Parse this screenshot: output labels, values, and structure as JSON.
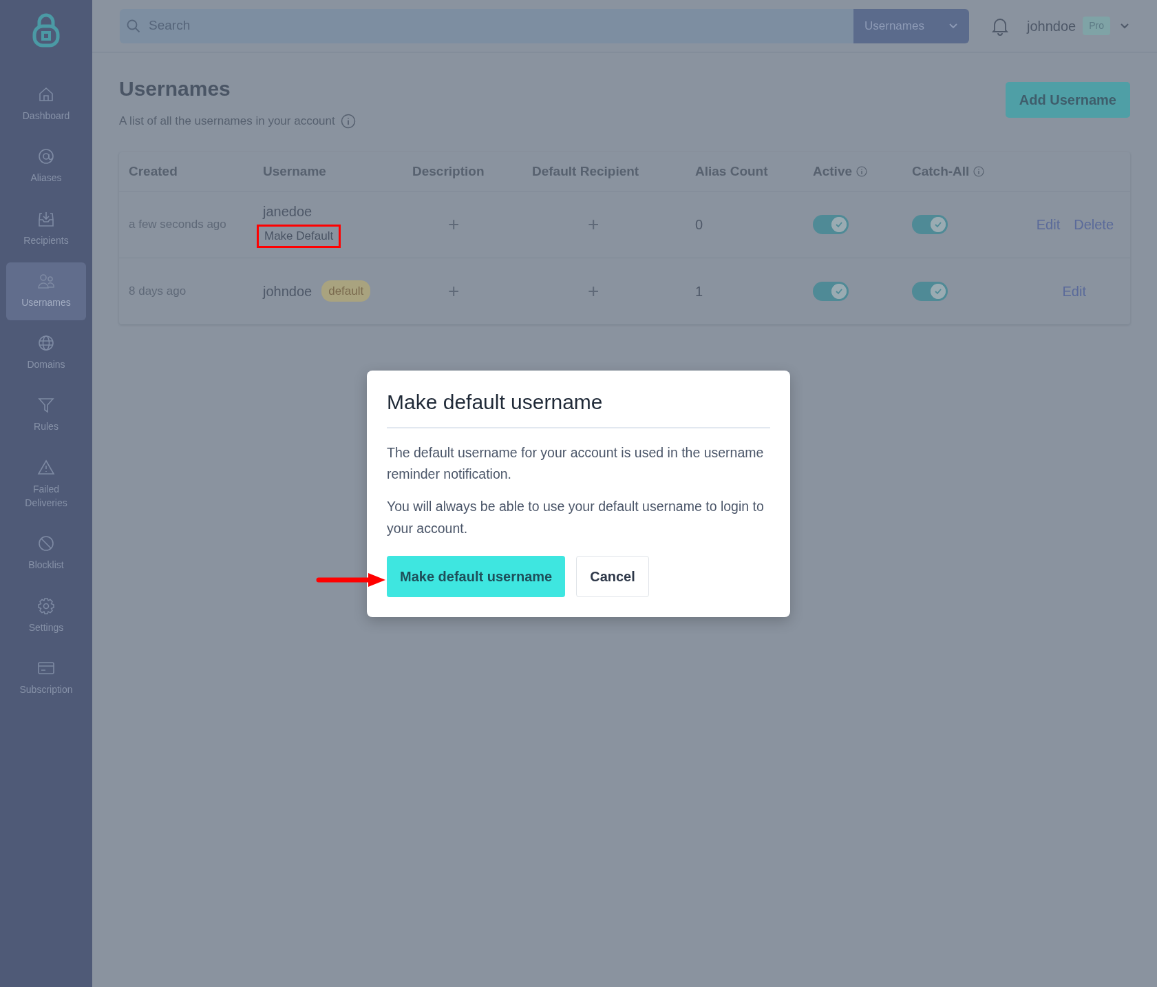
{
  "sidebar": {
    "items": [
      {
        "label": "Dashboard",
        "selected": false
      },
      {
        "label": "Aliases",
        "selected": false
      },
      {
        "label": "Recipients",
        "selected": false
      },
      {
        "label": "Usernames",
        "selected": true
      },
      {
        "label": "Domains",
        "selected": false
      },
      {
        "label": "Rules",
        "selected": false
      },
      {
        "label": "Failed Deliveries",
        "selected": false
      },
      {
        "label": "Blocklist",
        "selected": false
      },
      {
        "label": "Settings",
        "selected": false
      },
      {
        "label": "Subscription",
        "selected": false
      }
    ]
  },
  "header": {
    "search": {
      "placeholder": "Search"
    },
    "scope_dropdown": "Usernames",
    "user": "johndoe",
    "plan_badge": "Pro"
  },
  "page": {
    "title": "Usernames",
    "subtitle": "A list of all the usernames in your account",
    "add_button": "Add Username"
  },
  "table": {
    "columns": [
      {
        "label": "Created",
        "info": false
      },
      {
        "label": "Username",
        "info": false
      },
      {
        "label": "Description",
        "info": false
      },
      {
        "label": "Default Recipient",
        "info": false
      },
      {
        "label": "Alias Count",
        "info": false
      },
      {
        "label": "Active",
        "info": true
      },
      {
        "label": "Catch-All",
        "info": true
      }
    ],
    "rows": [
      {
        "created": "a few seconds ago",
        "username": "janedoe",
        "make_default": {
          "label": "Make Default",
          "highlighted": true
        },
        "badge": null,
        "description": "+",
        "default_recipient": "+",
        "alias_count": "0",
        "active": true,
        "catch_all": true,
        "actions": [
          "Edit",
          "Delete"
        ]
      },
      {
        "created": "8 days ago",
        "username": "johndoe",
        "make_default": null,
        "badge": "default",
        "description": "+",
        "default_recipient": "+",
        "alias_count": "1",
        "active": true,
        "catch_all": true,
        "actions": [
          "Edit"
        ]
      }
    ]
  },
  "modal": {
    "title": "Make default username",
    "paragraphs": [
      "The default username for your account is used in the username reminder notification.",
      "You will always be able to use your default username to login to your account."
    ],
    "buttons": [
      {
        "label": "Make default username",
        "kind": "primary",
        "pointed_at": true
      },
      {
        "label": "Cancel",
        "kind": "secondary",
        "pointed_at": false
      }
    ]
  }
}
